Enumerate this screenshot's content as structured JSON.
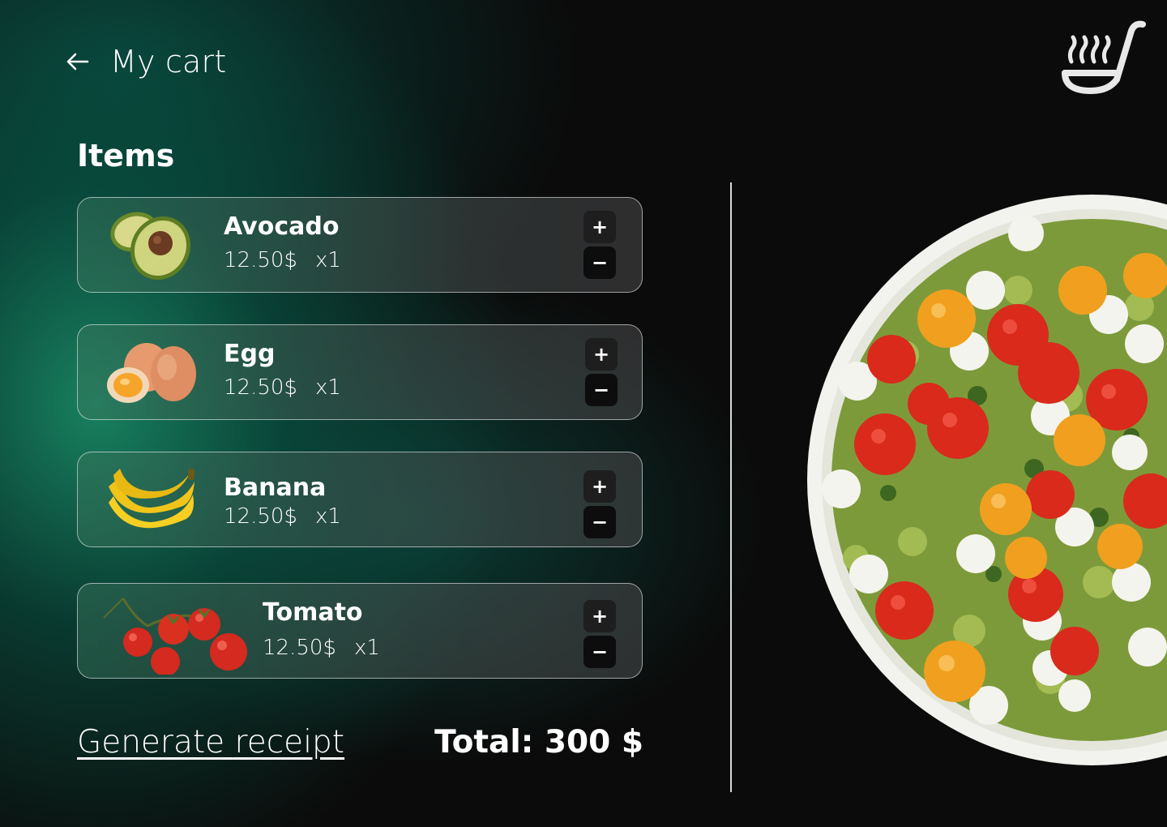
{
  "header": {
    "title": "My cart"
  },
  "items_section": {
    "title": "Items",
    "items": [
      {
        "name": "Avocado",
        "price": "12.50$",
        "qty": "x1",
        "image": "avocado-image"
      },
      {
        "name": "Egg",
        "price": "12.50$",
        "qty": "x1",
        "image": "egg-image"
      },
      {
        "name": "Banana",
        "price": "12.50$",
        "qty": "x1",
        "image": "banana-image"
      },
      {
        "name": "Tomato",
        "price": "12.50$",
        "qty": "x1",
        "image": "tomato-image"
      }
    ],
    "increment_label": "+",
    "decrement_label": "−"
  },
  "footer": {
    "receipt_link": "Generate receipt",
    "total": "Total: 300 $"
  },
  "colors": {
    "background": "#0b0b0b",
    "accent_green": "#1a966e",
    "button_bg": "#0d0d0d"
  }
}
